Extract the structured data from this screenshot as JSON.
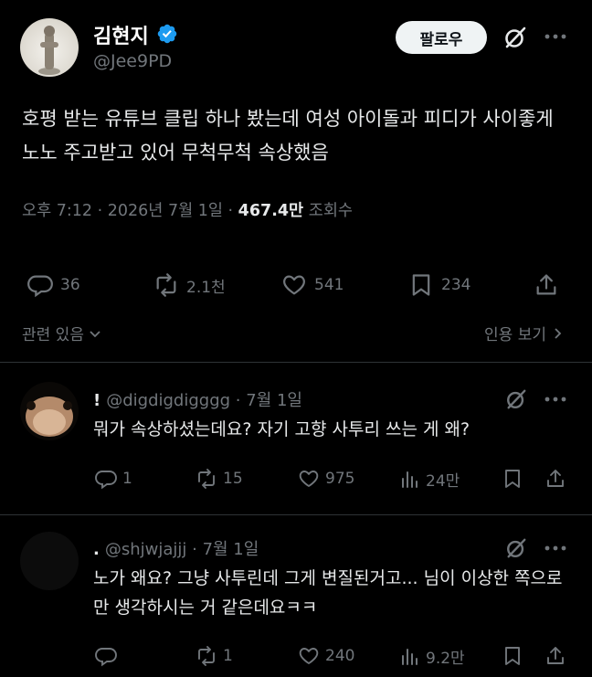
{
  "post": {
    "author_name": "김현지",
    "handle": "@Jee9PD",
    "follow_label": "팔로우",
    "text": "호평 받는 유튜브 클립 하나 봤는데 여성 아이돌과 피디가 사이좋게 노노 주고받고 있어 무척무척 속상했음",
    "time": "오후 7:12 · 2026년 7월 1일 · ",
    "views": "467.4만",
    "views_label": "조회수",
    "actions": {
      "replies": "36",
      "reposts": "2.1천",
      "likes": "541",
      "bookmarks": "234"
    },
    "related_label": "관련 있음",
    "quotes_label": "인용 보기"
  },
  "replies": [
    {
      "dot": "!",
      "handle": "@digdigdigggg",
      "date": "· 7월 1일",
      "text": "뭐가 속상하셨는데요? 자기 고향 사투리 쓰는 게 왜?",
      "replies": "1",
      "reposts": "15",
      "likes": "975",
      "views": "24만"
    },
    {
      "dot": ".",
      "handle": "@shjwjajjj",
      "date": "· 7월 1일",
      "text": "노가 왜요? 그냥 사투린데 그게 변질된거고... 님이 이상한 쪽으로만 생각하시는 거 같은데요ㅋㅋ",
      "replies": "",
      "reposts": "1",
      "likes": "240",
      "views": "9.2만"
    }
  ],
  "colors": {
    "background": "#000000",
    "text": "#e7e9ea",
    "muted": "#71767b",
    "verified": "#1d9bf0",
    "divider": "#2f3336"
  }
}
